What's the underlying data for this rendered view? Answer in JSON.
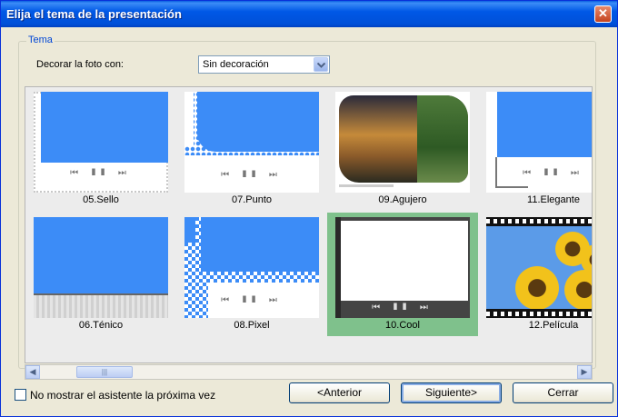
{
  "window": {
    "title": "Elija el tema de la presentación"
  },
  "group": {
    "legend": "Tema"
  },
  "decorate": {
    "label": "Decorar la foto con:",
    "selected": "Sin decoración"
  },
  "themes": [
    {
      "label": "05.Sello"
    },
    {
      "label": "07.Punto"
    },
    {
      "label": "09.Agujero"
    },
    {
      "label": "11.Elegante"
    },
    {
      "label": "06.Ténico"
    },
    {
      "label": "08.Pixel"
    },
    {
      "label": "10.Cool",
      "selected": true
    },
    {
      "label": "12.Película"
    }
  ],
  "checkbox": {
    "label": "No mostrar el asistente la próxima vez",
    "checked": false
  },
  "buttons": {
    "back": "<Anterior",
    "next": "Siguiente>",
    "close": "Cerrar"
  },
  "colors": {
    "accent": "#3c8cf7",
    "selected": "#7fc18c"
  },
  "player_controls": "⏮ ❚❚ ⏭"
}
